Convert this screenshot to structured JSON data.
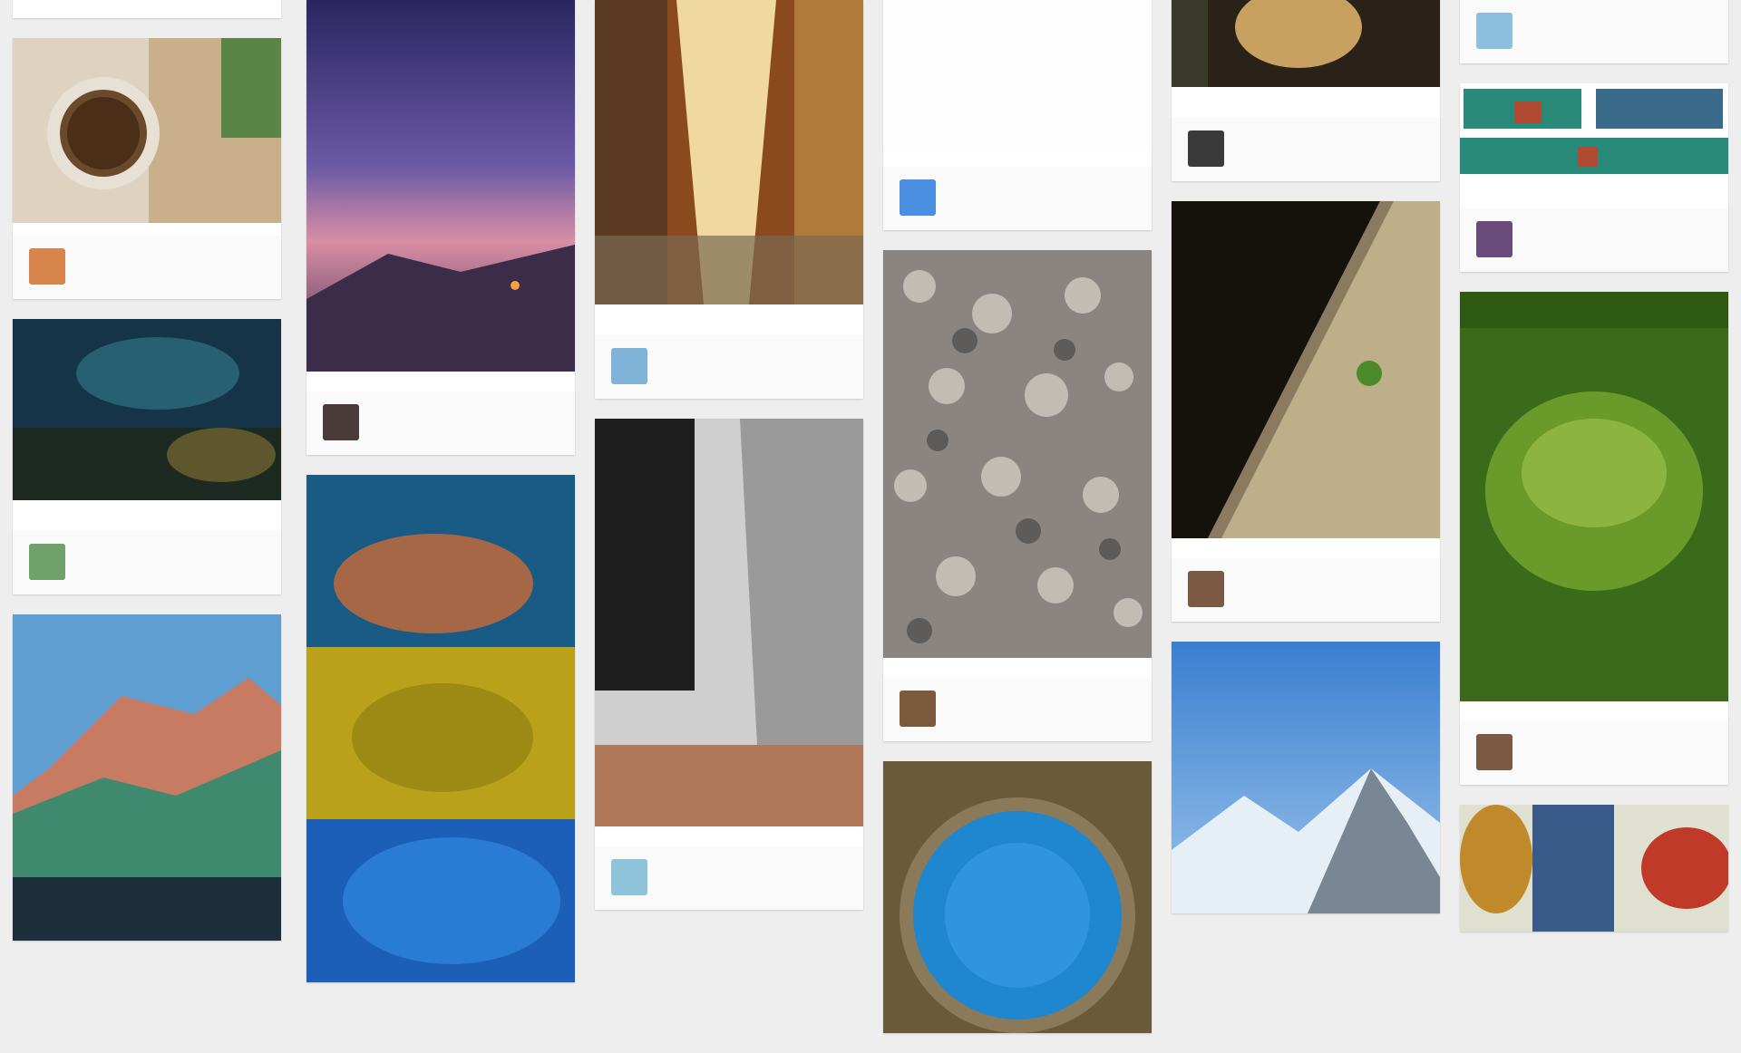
{
  "columns": [
    {
      "name": "col-1",
      "cards": [
        {
          "id": "c1-0",
          "desc": "",
          "meta": "",
          "user": "",
          "board": "",
          "img_colors": [
            "#e8e6e2",
            "#d9d6d0"
          ],
          "avatar": "#c8c2b8"
        },
        {
          "id": "c1-1",
          "desc": "",
          "meta": "",
          "user": "",
          "board": "",
          "img_colors": [
            "#6b4a2c",
            "#c9b08a",
            "#e7e0d4",
            "#3e7a35"
          ],
          "avatar": "#d7854a"
        },
        {
          "id": "c1-2",
          "desc": "",
          "meta": "",
          "user": "",
          "board": "",
          "img_colors": [
            "#163447",
            "#2c6c7a",
            "#1d2a22",
            "#7a6a30"
          ],
          "avatar": "#6ea26a"
        },
        {
          "id": "c1-3",
          "desc": "",
          "meta": "",
          "user": "",
          "board": "",
          "img_colors": [
            "#5f9ed0",
            "#c77b62",
            "#3f8a6f",
            "#1e2f3c"
          ],
          "avatar": ""
        }
      ]
    },
    {
      "name": "col-2",
      "cards": [
        {
          "id": "c2-0",
          "desc": "",
          "meta": "",
          "user": "",
          "board": "",
          "img_colors": [
            "#2a2560",
            "#6b5aa6",
            "#d98ea5",
            "#3b2c4a"
          ],
          "avatar": "#4a3a3a"
        },
        {
          "id": "c2-1",
          "desc": "",
          "meta": "",
          "user": "",
          "board": "",
          "img_colors": [
            "#1a5b86",
            "#c06a3c",
            "#b9a21a",
            "#1c5fb8"
          ],
          "avatar": ""
        }
      ]
    },
    {
      "name": "col-3",
      "cards": [
        {
          "id": "c3-0",
          "desc": "",
          "meta": "",
          "user": "",
          "board": "",
          "img_colors": [
            "#8a4a1e",
            "#f0d9a0",
            "#b07a3a",
            "#5a3a22"
          ],
          "avatar": "#7fb4d8"
        },
        {
          "id": "c3-1",
          "desc": "",
          "meta": "",
          "user": "",
          "board": "",
          "img_colors": [
            "#1e1e1e",
            "#cfcfcf",
            "#9a9a9a",
            "#b07a5a"
          ],
          "avatar": "#8fc3da"
        }
      ]
    },
    {
      "name": "col-4",
      "cards": [
        {
          "id": "c4-0",
          "desc": "",
          "meta": "",
          "user": "",
          "board": "",
          "img_colors": [],
          "avatar": "#4a8fe0"
        },
        {
          "id": "c4-1",
          "desc": "",
          "meta": "",
          "user": "",
          "board": "",
          "img_colors": [
            "#4a4a4a",
            "#8a8580",
            "#cfcac2",
            "#2a2a2a"
          ],
          "avatar": "#7a5a3a"
        },
        {
          "id": "c4-2",
          "desc": "",
          "meta": "",
          "user": "",
          "board": "",
          "img_colors": [
            "#6a5a3a",
            "#1f86d0",
            "#3aa0e8",
            "#8a7a5a"
          ],
          "avatar": ""
        }
      ]
    },
    {
      "name": "col-5",
      "cards": [
        {
          "id": "c5-0",
          "desc": "",
          "meta": "",
          "user": "",
          "board": "",
          "img_colors": [
            "#2a2218",
            "#c8a060",
            "#3a3a2a"
          ],
          "avatar": "#3a3a3a"
        },
        {
          "id": "c5-1",
          "desc": "",
          "meta": "",
          "user": "",
          "board": "",
          "img_colors": [
            "#15120c",
            "#8a7a60",
            "#4a8a2a",
            "#bfae8a"
          ],
          "avatar": "#7a5a42"
        },
        {
          "id": "c5-2",
          "desc": "",
          "meta": "",
          "user": "",
          "board": "",
          "img_colors": [
            "#3a7fd0",
            "#9cc4ea",
            "#e6eef6",
            "#4a5a6a"
          ],
          "avatar": ""
        }
      ]
    },
    {
      "name": "col-6",
      "cards": [
        {
          "id": "c6-0",
          "desc": "",
          "meta": "",
          "user": "",
          "board": "",
          "img_colors": [],
          "avatar": "#8ac0de"
        },
        {
          "id": "c6-1",
          "desc": "",
          "meta": "",
          "user": "",
          "board": "",
          "img_colors": [
            "#2a8a7a",
            "#b04a30",
            "#3a6a8a",
            "#ffffff"
          ],
          "avatar": "#6a4a7a"
        },
        {
          "id": "c6-2",
          "desc": "",
          "meta": "",
          "user": "",
          "board": "",
          "img_colors": [
            "#2f5a14",
            "#6a9a2a",
            "#9ac04a",
            "#3a6a1a"
          ],
          "avatar": "#7a5a42"
        },
        {
          "id": "c6-3",
          "desc": "",
          "meta": "",
          "user": "",
          "board": "",
          "img_colors": [
            "#c08a2a",
            "#3a5a8a",
            "#c03a2a",
            "#e0e0d0"
          ],
          "avatar": ""
        }
      ]
    }
  ]
}
